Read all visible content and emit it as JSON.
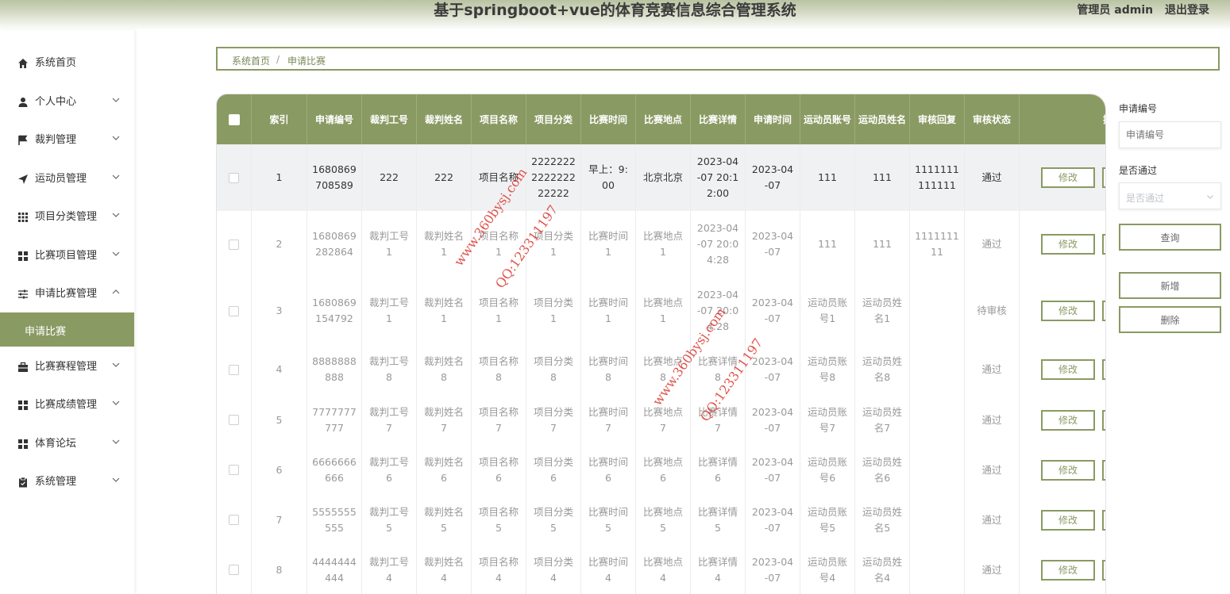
{
  "header": {
    "title": "基于springboot+vue的体育竞赛信息综合管理系统",
    "user_label": "管理员 admin",
    "logout_label": "退出登录"
  },
  "sidebar": {
    "items": [
      {
        "label": "系统首页",
        "icon": "home-icon"
      },
      {
        "label": "个人中心",
        "icon": "user-icon"
      },
      {
        "label": "裁判管理",
        "icon": "flag-icon"
      },
      {
        "label": "运动员管理",
        "icon": "send-icon"
      },
      {
        "label": "项目分类管理",
        "icon": "grid-icon"
      },
      {
        "label": "比赛项目管理",
        "icon": "apps-icon"
      },
      {
        "label": "申请比赛管理",
        "icon": "sliders-icon"
      },
      {
        "label": "比赛赛程管理",
        "icon": "briefcase-icon"
      },
      {
        "label": "比赛成绩管理",
        "icon": "apps-icon"
      },
      {
        "label": "体育论坛",
        "icon": "apps-icon"
      },
      {
        "label": "系统管理",
        "icon": "clipboard-icon"
      }
    ],
    "active_sub": "申请比赛"
  },
  "breadcrumb": {
    "home": "系统首页",
    "separator": "/",
    "current": "申请比赛"
  },
  "table": {
    "headers": [
      "索引",
      "申请编号",
      "裁判工号",
      "裁判姓名",
      "项目名称",
      "项目分类",
      "比赛时间",
      "比赛地点",
      "比赛详情",
      "申请时间",
      "运动员账号",
      "运动员姓名",
      "审核回复",
      "审核状态",
      "操作"
    ],
    "edit_label": "修改",
    "rows": [
      [
        "1",
        "1680869708589",
        "222",
        "222",
        "项目名称",
        "2222222222222222222",
        "早上：9:00",
        "北京北京",
        "2023-04-07 20:12:00",
        "2023-04-07",
        "111",
        "111",
        "1111111111111",
        "通过"
      ],
      [
        "2",
        "1680869282864",
        "裁判工号1",
        "裁判姓名1",
        "项目名称1",
        "项目分类1",
        "比赛时间1",
        "比赛地点1",
        "2023-04-07 20:04:28",
        "2023-04-07",
        "111",
        "111",
        "111111111",
        "通过"
      ],
      [
        "3",
        "1680869154792",
        "裁判工号1",
        "裁判姓名1",
        "项目名称1",
        "项目分类1",
        "比赛时间1",
        "比赛地点1",
        "2023-04-07 20:04:28",
        "2023-04-07",
        "运动员账号1",
        "运动员姓名1",
        "",
        "待审核"
      ],
      [
        "4",
        "8888888888",
        "裁判工号8",
        "裁判姓名8",
        "项目名称8",
        "项目分类8",
        "比赛时间8",
        "比赛地点8",
        "比赛详情8",
        "2023-04-07",
        "运动员账号8",
        "运动员姓名8",
        "",
        "通过"
      ],
      [
        "5",
        "7777777777",
        "裁判工号7",
        "裁判姓名7",
        "项目名称7",
        "项目分类7",
        "比赛时间7",
        "比赛地点7",
        "比赛详情7",
        "2023-04-07",
        "运动员账号7",
        "运动员姓名7",
        "",
        "通过"
      ],
      [
        "6",
        "6666666666",
        "裁判工号6",
        "裁判姓名6",
        "项目名称6",
        "项目分类6",
        "比赛时间6",
        "比赛地点6",
        "比赛详情6",
        "2023-04-07",
        "运动员账号6",
        "运动员姓名6",
        "",
        "通过"
      ],
      [
        "7",
        "5555555555",
        "裁判工号5",
        "裁判姓名5",
        "项目名称5",
        "项目分类5",
        "比赛时间5",
        "比赛地点5",
        "比赛详情5",
        "2023-04-07",
        "运动员账号5",
        "运动员姓名5",
        "",
        "通过"
      ],
      [
        "8",
        "4444444444",
        "裁判工号4",
        "裁判姓名4",
        "项目名称4",
        "项目分类4",
        "比赛时间4",
        "比赛地点4",
        "比赛详情4",
        "2023-04-07",
        "运动员账号4",
        "运动员姓名4",
        "",
        "通过"
      ]
    ]
  },
  "search": {
    "apply_no_label": "申请编号",
    "apply_no_placeholder": "申请编号",
    "approved_label": "是否通过",
    "approved_placeholder": "是否通过",
    "query_label": "查询",
    "add_label": "新增",
    "delete_label": "删除"
  },
  "watermark": {
    "site": "www.360bysj.com",
    "qq": "QQ:123311197"
  },
  "colors": {
    "accent": "#8a9a63",
    "header_top": "#b9c3a2",
    "watermark": "#d9342b"
  }
}
